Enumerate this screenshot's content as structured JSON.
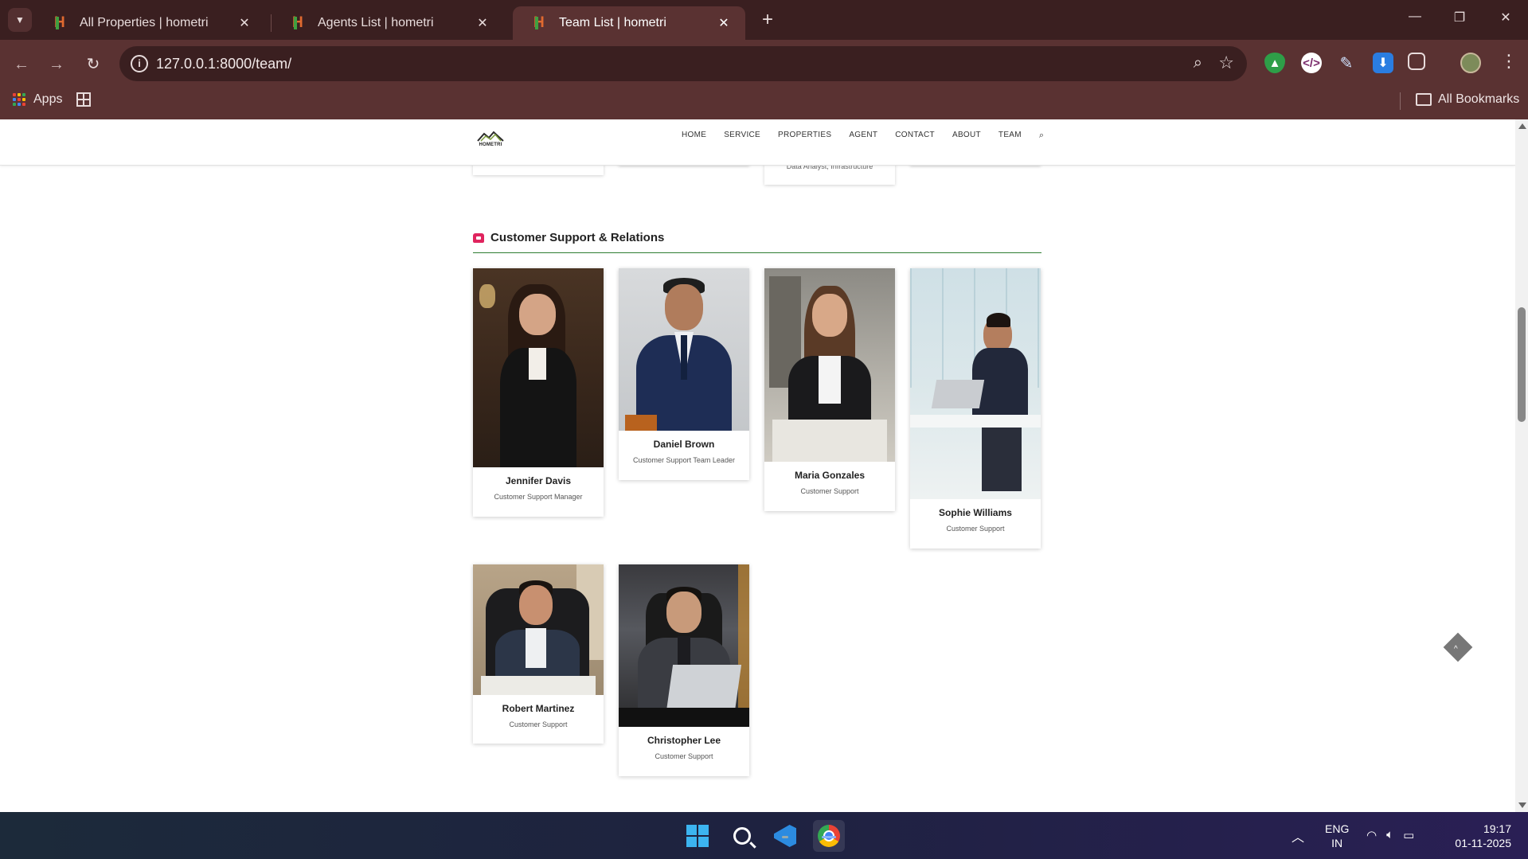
{
  "browser": {
    "tabs": [
      {
        "title": "All Properties | hometri",
        "active": false
      },
      {
        "title": "Agents List | hometri",
        "active": false
      },
      {
        "title": "Team List | hometri",
        "active": true
      }
    ],
    "url": "127.0.0.1:8000/team/",
    "bookmarks": {
      "apps_label": "Apps",
      "all_bookmarks_label": "All Bookmarks"
    }
  },
  "site": {
    "logo_text": "HOMETRI",
    "nav": [
      "HOME",
      "SERVICE",
      "PROPERTIES",
      "AGENT",
      "CONTACT",
      "ABOUT",
      "TEAM"
    ],
    "previous_section_peek_role": "Data Analyst, Infrastructure",
    "section": {
      "title": "Customer Support & Relations",
      "members": [
        {
          "name": "Jennifer Davis",
          "role": "Customer Support Manager"
        },
        {
          "name": "Daniel Brown",
          "role": "Customer Support Team Leader"
        },
        {
          "name": "Maria Gonzales",
          "role": "Customer Support"
        },
        {
          "name": "Sophie Williams",
          "role": "Customer Support"
        },
        {
          "name": "Robert Martinez",
          "role": "Customer Support"
        },
        {
          "name": "Christopher Lee",
          "role": "Customer Support"
        }
      ]
    }
  },
  "taskbar": {
    "language": "ENG",
    "region": "IN",
    "time": "19:17",
    "date": "01-11-2025"
  },
  "colors": {
    "tab_bar": "#3a1f20",
    "toolbar": "#5a3232",
    "section_rule": "#2e7d32",
    "section_icon": "#e0245e"
  }
}
